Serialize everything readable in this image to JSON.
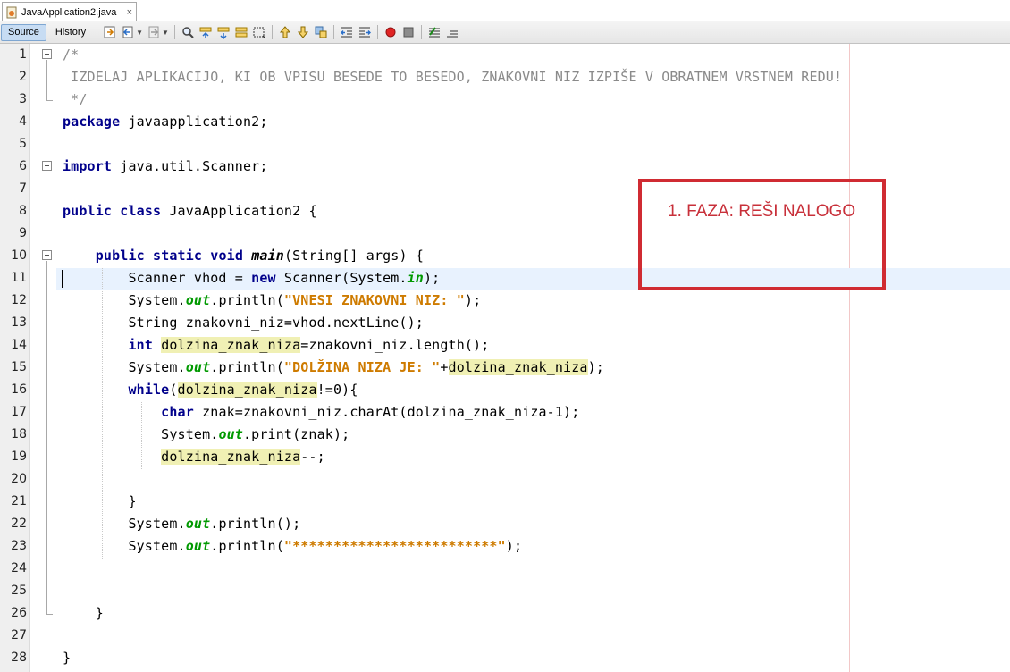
{
  "tab": {
    "title": "JavaApplication2.java",
    "close": "×"
  },
  "toolbar": {
    "source_label": "Source",
    "history_label": "History"
  },
  "editor": {
    "line_numbers": [
      "1",
      "2",
      "3",
      "4",
      "5",
      "6",
      "7",
      "8",
      "9",
      "10",
      "11",
      "12",
      "13",
      "14",
      "15",
      "16",
      "17",
      "18",
      "19",
      "20",
      "21",
      "22",
      "23",
      "24",
      "25",
      "26",
      "27",
      "28"
    ],
    "lines": [
      [
        {
          "t": "/*",
          "c": "cmt"
        }
      ],
      [
        {
          "t": " IZDELAJ APLIKACIJO, KI OB VPISU BESEDE TO BESEDO, ZNAKOVNI NIZ IZPIŠE V OBRATNEM VRSTNEM REDU!",
          "c": "cmt"
        }
      ],
      [
        {
          "t": " */",
          "c": "cmt"
        }
      ],
      [
        {
          "t": "package",
          "c": "kw"
        },
        {
          "t": " javaapplication2;"
        }
      ],
      [],
      [
        {
          "t": "import",
          "c": "kw"
        },
        {
          "t": " java.util.Scanner;"
        }
      ],
      [],
      [
        {
          "t": "public",
          "c": "kw"
        },
        {
          "t": " "
        },
        {
          "t": "class",
          "c": "kw"
        },
        {
          "t": " JavaApplication2 {"
        }
      ],
      [],
      [
        {
          "t": "    "
        },
        {
          "t": "public",
          "c": "kw"
        },
        {
          "t": " "
        },
        {
          "t": "static",
          "c": "kw"
        },
        {
          "t": " "
        },
        {
          "t": "void",
          "c": "kw"
        },
        {
          "t": " "
        },
        {
          "t": "main",
          "c": "mth"
        },
        {
          "t": "(String[] args) {"
        }
      ],
      [
        {
          "t": "        Scanner vhod = "
        },
        {
          "t": "new",
          "c": "kw"
        },
        {
          "t": " Scanner(System."
        },
        {
          "t": "in",
          "c": "fld"
        },
        {
          "t": ");"
        }
      ],
      [
        {
          "t": "        System."
        },
        {
          "t": "out",
          "c": "fld"
        },
        {
          "t": ".println("
        },
        {
          "t": "\"VNESI ZNAKOVNI NIZ: \"",
          "c": "str"
        },
        {
          "t": ");"
        }
      ],
      [
        {
          "t": "        String znakovni_niz=vhod.nextLine();"
        }
      ],
      [
        {
          "t": "        "
        },
        {
          "t": "int",
          "c": "kw"
        },
        {
          "t": " "
        },
        {
          "t": "dolzina_znak_niza",
          "c": "mark"
        },
        {
          "t": "=znakovni_niz.length();"
        }
      ],
      [
        {
          "t": "        System."
        },
        {
          "t": "out",
          "c": "fld"
        },
        {
          "t": ".println("
        },
        {
          "t": "\"DOLŽINA NIZA JE: \"",
          "c": "str"
        },
        {
          "t": "+"
        },
        {
          "t": "dolzina_znak_niza",
          "c": "mark"
        },
        {
          "t": ");"
        }
      ],
      [
        {
          "t": "        "
        },
        {
          "t": "while",
          "c": "kw"
        },
        {
          "t": "("
        },
        {
          "t": "dolzina_znak_niza",
          "c": "mark"
        },
        {
          "t": "!=0){"
        }
      ],
      [
        {
          "t": "            "
        },
        {
          "t": "char",
          "c": "kw"
        },
        {
          "t": " znak=znakovni_niz.charAt(dolzina_znak_niza-1);"
        }
      ],
      [
        {
          "t": "            System."
        },
        {
          "t": "out",
          "c": "fld"
        },
        {
          "t": ".print(znak);"
        }
      ],
      [
        {
          "t": "            "
        },
        {
          "t": "dolzina_znak_niza",
          "c": "mark"
        },
        {
          "t": "--;"
        }
      ],
      [],
      [
        {
          "t": "        }"
        }
      ],
      [
        {
          "t": "        System."
        },
        {
          "t": "out",
          "c": "fld"
        },
        {
          "t": ".println();"
        }
      ],
      [
        {
          "t": "        System."
        },
        {
          "t": "out",
          "c": "fld"
        },
        {
          "t": ".println("
        },
        {
          "t": "\"*************************\"",
          "c": "str"
        },
        {
          "t": ");"
        }
      ],
      [],
      [],
      [
        {
          "t": "    }"
        }
      ],
      [],
      [
        {
          "t": "}"
        }
      ]
    ]
  },
  "annotation": {
    "text": "1. FAZA: REŠI NALOGO",
    "color": "#d02b32"
  },
  "colors": {
    "keyword": "#00008b",
    "string": "#ce7b00",
    "field": "#009900",
    "comment": "#8a8a8a",
    "mark_occurrence": "#f0f0b4",
    "current_line": "#e8f2fe"
  },
  "icons": [
    "java-file-icon",
    "back-history-icon",
    "forward-history-icon",
    "find-icon",
    "find-previous-icon",
    "find-next-icon",
    "toggle-highlight-icon",
    "toggle-rect-selection-icon",
    "previous-bookmark-icon",
    "next-bookmark-icon",
    "toggle-bookmark-icon",
    "shift-left-icon",
    "shift-right-icon",
    "start-macro-icon",
    "stop-macro-icon",
    "comment-icon",
    "uncomment-icon"
  ]
}
